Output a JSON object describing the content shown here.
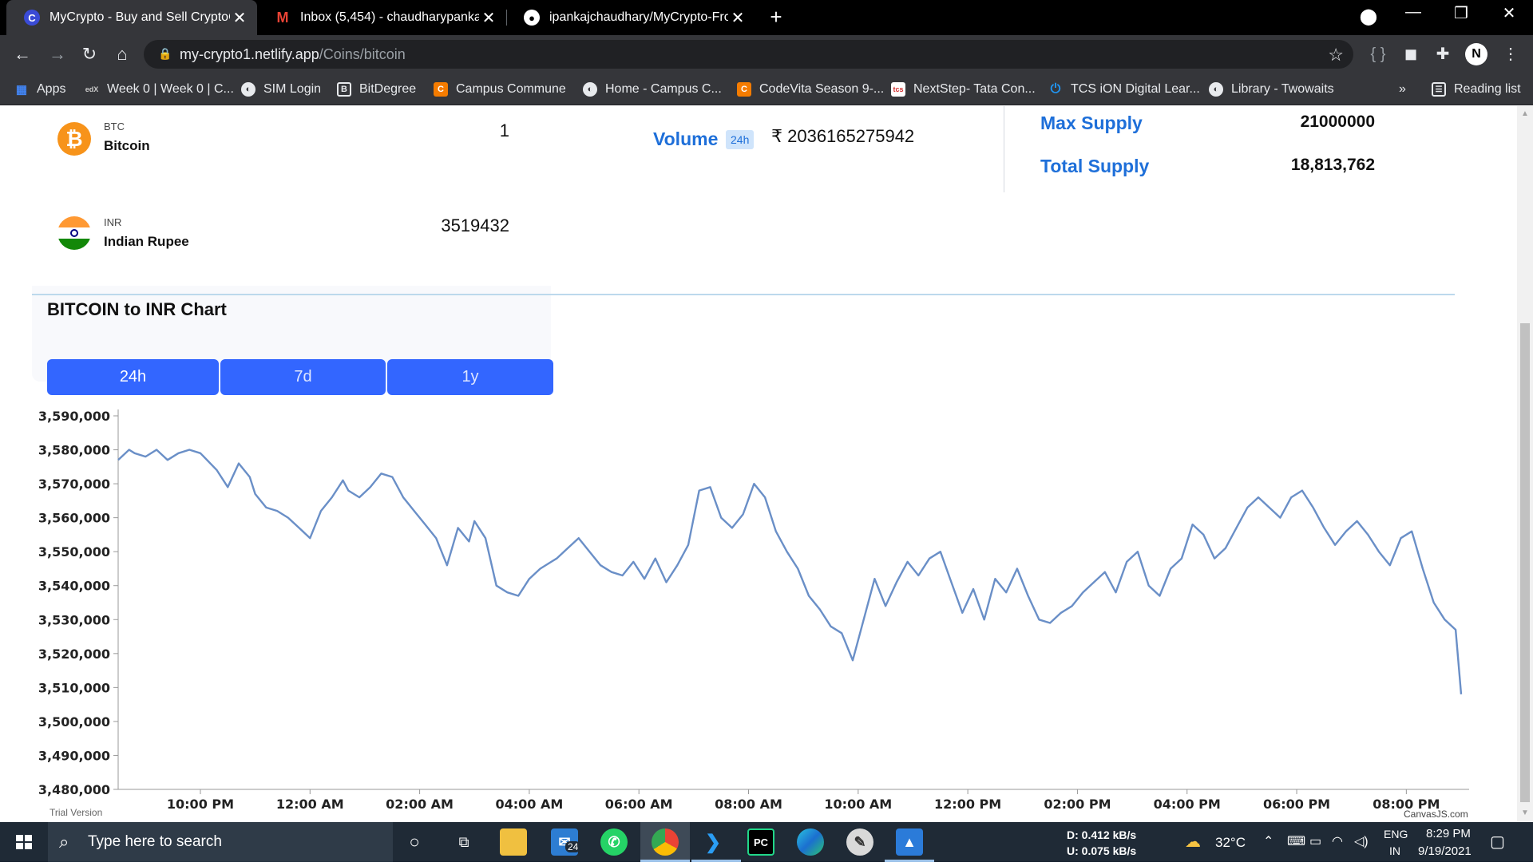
{
  "browser": {
    "tabs": [
      {
        "title": "MyCrypto - Buy and Sell CryptoC",
        "icon": "mycrypto-icon",
        "active": true
      },
      {
        "title": "Inbox (5,454) - chaudharypankaja",
        "icon": "gmail-icon",
        "active": false
      },
      {
        "title": "ipankajchaudhary/MyCrypto-Fro",
        "icon": "github-icon",
        "active": false
      }
    ],
    "new_tab": "+",
    "url_host": "my-crypto1.netlify.app",
    "url_path": "/Coins/bitcoin",
    "bookmarks": [
      {
        "label": "Apps",
        "icon": "apps-grid-icon"
      },
      {
        "label": "Week 0 | Week 0 | C...",
        "icon": "edx-icon"
      },
      {
        "label": "SIM Login",
        "icon": "globe-icon"
      },
      {
        "label": "BitDegree",
        "icon": "bitdegree-icon"
      },
      {
        "label": "Campus Commune",
        "icon": "campus-icon"
      },
      {
        "label": "Home - Campus C...",
        "icon": "globe-icon"
      },
      {
        "label": "CodeVita Season 9-...",
        "icon": "campus-icon"
      },
      {
        "label": "NextStep- Tata Con...",
        "icon": "tcs-icon"
      },
      {
        "label": "TCS iON Digital Lear...",
        "icon": "power-icon"
      },
      {
        "label": "Library - Twowaits",
        "icon": "globe-icon"
      }
    ],
    "bookmarks_overflow": "»",
    "reading_list": "Reading list"
  },
  "converter": {
    "from": {
      "symbol": "BTC",
      "name": "Bitcoin",
      "amount": "1"
    },
    "to": {
      "symbol": "INR",
      "name": "Indian Rupee",
      "amount": "3519432"
    }
  },
  "stats": {
    "volume_label": "Volume",
    "volume_badge": "24h",
    "volume_value": "₹  2036165275942",
    "max_supply_label": "Max Supply",
    "max_supply_value": "21000000",
    "total_supply_label": "Total Supply",
    "total_supply_value": "18,813,762"
  },
  "chart_title": "BITCOIN to INR Chart",
  "range_buttons": [
    "24h",
    "7d",
    "1y"
  ],
  "trial_text": "Trial Version",
  "credit_text": "CanvasJS.com",
  "chart_data": {
    "type": "line",
    "title": "BITCOIN to INR Chart",
    "xlabel": "",
    "ylabel": "",
    "ylim": [
      3480000,
      3590000
    ],
    "yticks": [
      "3,590,000",
      "3,580,000",
      "3,570,000",
      "3,560,000",
      "3,550,000",
      "3,540,000",
      "3,530,000",
      "3,520,000",
      "3,510,000",
      "3,500,000",
      "3,490,000",
      "3,480,000"
    ],
    "xticks": [
      "10:00 PM",
      "12:00 AM",
      "02:00 AM",
      "04:00 AM",
      "06:00 AM",
      "08:00 AM",
      "10:00 AM",
      "12:00 PM",
      "02:00 PM",
      "04:00 PM",
      "06:00 PM",
      "08:00 PM"
    ],
    "xrange_hours": [
      -1.5,
      23.0
    ],
    "line_color": "#6a8fc7",
    "points_hours": [
      -1.5,
      -1.3,
      -1.2,
      -1.0,
      -0.8,
      -0.6,
      -0.4,
      -0.2,
      0.0,
      0.3,
      0.5,
      0.7,
      0.9,
      1.0,
      1.2,
      1.4,
      1.6,
      1.8,
      2.0,
      2.2,
      2.4,
      2.6,
      2.7,
      2.9,
      3.1,
      3.3,
      3.5,
      3.7,
      3.9,
      4.1,
      4.3,
      4.5,
      4.7,
      4.9,
      5.0,
      5.2,
      5.4,
      5.6,
      5.8,
      6.0,
      6.2,
      6.4,
      6.5,
      6.7,
      6.9,
      7.1,
      7.3,
      7.5,
      7.7,
      7.9,
      8.1,
      8.3,
      8.5,
      8.7,
      8.9,
      9.1,
      9.3,
      9.5,
      9.7,
      9.9,
      10.1,
      10.3,
      10.5,
      10.7,
      10.9,
      11.1,
      11.3,
      11.5,
      11.7,
      11.9,
      12.1,
      12.3,
      12.5,
      12.7,
      12.9,
      13.1,
      13.3,
      13.5,
      13.7,
      13.9,
      14.1,
      14.3,
      14.5,
      14.7,
      14.9,
      15.1,
      15.3,
      15.5,
      15.7,
      15.9,
      16.1,
      16.3,
      16.5,
      16.7,
      16.9,
      17.1,
      17.3,
      17.5,
      17.7,
      17.9,
      18.1,
      18.3,
      18.5,
      18.7,
      18.9,
      19.1,
      19.3,
      19.5,
      19.7,
      19.9,
      20.1,
      20.3,
      20.5,
      20.7,
      20.9,
      21.1,
      21.3,
      21.5,
      21.7,
      21.9,
      22.1,
      22.3,
      22.5,
      22.7,
      22.9,
      23.0
    ],
    "values": [
      3577000,
      3580000,
      3579000,
      3578000,
      3580000,
      3577000,
      3579000,
      3580000,
      3579000,
      3574000,
      3569000,
      3576000,
      3572000,
      3567000,
      3563000,
      3562000,
      3560000,
      3557000,
      3554000,
      3562000,
      3566000,
      3571000,
      3568000,
      3566000,
      3569000,
      3573000,
      3572000,
      3566000,
      3562000,
      3558000,
      3554000,
      3546000,
      3557000,
      3553000,
      3559000,
      3554000,
      3540000,
      3538000,
      3537000,
      3542000,
      3545000,
      3547000,
      3548000,
      3551000,
      3554000,
      3550000,
      3546000,
      3544000,
      3543000,
      3547000,
      3542000,
      3548000,
      3541000,
      3546000,
      3552000,
      3568000,
      3569000,
      3560000,
      3557000,
      3561000,
      3570000,
      3566000,
      3556000,
      3550000,
      3545000,
      3537000,
      3533000,
      3528000,
      3526000,
      3518000,
      3530000,
      3542000,
      3534000,
      3541000,
      3547000,
      3543000,
      3548000,
      3550000,
      3541000,
      3532000,
      3539000,
      3530000,
      3542000,
      3538000,
      3545000,
      3537000,
      3530000,
      3529000,
      3532000,
      3534000,
      3538000,
      3541000,
      3544000,
      3538000,
      3547000,
      3550000,
      3540000,
      3537000,
      3545000,
      3548000,
      3558000,
      3555000,
      3548000,
      3551000,
      3557000,
      3563000,
      3566000,
      3563000,
      3560000,
      3566000,
      3568000,
      3563000,
      3557000,
      3552000,
      3556000,
      3559000,
      3555000,
      3550000,
      3546000,
      3554000,
      3556000,
      3545000,
      3535000,
      3530000,
      3527000,
      3508000
    ]
  },
  "taskbar": {
    "search_placeholder": "Type here to search",
    "mail_badge": "24",
    "net_down": "D:    0.412 kB/s",
    "net_up": "U:    0.075 kB/s",
    "temperature": "32°C",
    "lang_top": "ENG",
    "lang_bottom": "IN",
    "time": "8:29 PM",
    "date": "9/19/2021"
  }
}
